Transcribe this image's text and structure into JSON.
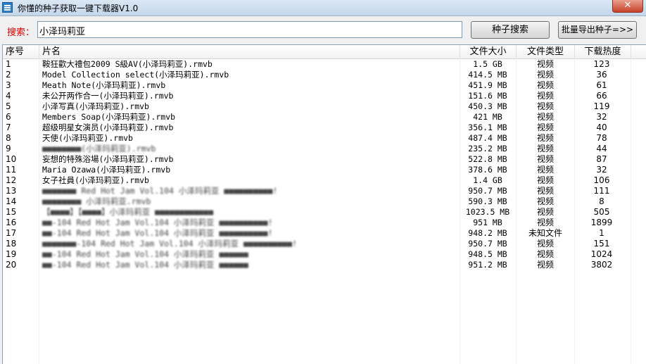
{
  "window": {
    "title": "你懂的种子获取一键下载器V1.0",
    "close_glyph": "✕"
  },
  "search": {
    "label": "搜索：",
    "value": "小泽玛莉亚",
    "search_button": "种子搜索",
    "export_button": "批量导出种子=>>"
  },
  "table": {
    "columns": [
      "序号",
      "片名",
      "文件大小",
      "文件类型",
      "下载热度"
    ],
    "rows": [
      {
        "idx": "1",
        "name": "鞍狂歡大禮包2009 S級AV(小泽玛莉亚).rmvb",
        "size": "1.5 GB",
        "type": "视频",
        "heat": "123"
      },
      {
        "idx": "2",
        "name": "Model Collection select(小泽玛莉亚).rmvb",
        "size": "414.5 MB",
        "type": "视频",
        "heat": "36"
      },
      {
        "idx": "3",
        "name": "Meath Note(小泽玛莉亚).rmvb",
        "size": "451.9 MB",
        "type": "视频",
        "heat": "61"
      },
      {
        "idx": "4",
        "name": "未公开两作合一(小泽玛莉亚).rmvb",
        "size": "151.6 MB",
        "type": "视频",
        "heat": "66"
      },
      {
        "idx": "5",
        "name": "小泽写真(小泽玛莉亚).rmvb",
        "size": "450.3 MB",
        "type": "视频",
        "heat": "119"
      },
      {
        "idx": "6",
        "name": "Members Soap(小泽玛莉亚).rmvb",
        "size": "421 MB",
        "type": "视频",
        "heat": "32"
      },
      {
        "idx": "7",
        "name": "超级明星女演员(小泽玛莉亚).rmvb",
        "size": "356.1 MB",
        "type": "视频",
        "heat": "40"
      },
      {
        "idx": "8",
        "name": "天使(小泽玛莉亚).rmvb",
        "size": "487.4 MB",
        "type": "视频",
        "heat": "78"
      },
      {
        "idx": "9",
        "name": "■■■■■■■■(小泽玛莉亚).rmvb",
        "size": "235.2 MB",
        "type": "视频",
        "heat": "44",
        "blurred": true
      },
      {
        "idx": "10",
        "name": "妄想的特殊浴場(小泽玛莉亚).rmvb",
        "size": "522.8 MB",
        "type": "视频",
        "heat": "87"
      },
      {
        "idx": "11",
        "name": "Maria Ozawa(小泽玛莉亚).rmvb",
        "size": "378.6 MB",
        "type": "视频",
        "heat": "32"
      },
      {
        "idx": "12",
        "name": "女子社員(小泽玛莉亚).rmvb",
        "size": "1.4 GB",
        "type": "视频",
        "heat": "106"
      },
      {
        "idx": "13",
        "name": "■■■■■■■ Red Hot Jam Vol.104 小泽玛莉亚 ■■■■■■■■■■!",
        "size": "950.7 MB",
        "type": "视频",
        "heat": "111",
        "blurred": true
      },
      {
        "idx": "14",
        "name": "■■■■■■■■ 小泽玛莉亚.rmvb",
        "size": "590.3 MB",
        "type": "视频",
        "heat": "8",
        "blurred": true
      },
      {
        "idx": "15",
        "name": "【■■■■】【■■■■】小泽玛莉亚 ■■■■■■■■■■■■",
        "size": "1023.5 MB",
        "type": "视频",
        "heat": "505",
        "blurred": true
      },
      {
        "idx": "16",
        "name": "■■-104 Red Hot Jam Vol.104 小泽玛莉亚 ■■■■■■■■■■!",
        "size": "951 MB",
        "type": "视频",
        "heat": "1899",
        "blurred": true
      },
      {
        "idx": "17",
        "name": "■■-104 Red Hot Jam Vol.104 小泽玛莉亚 ■■■■■■■■■■!",
        "size": "948.2 MB",
        "type": "未知文件",
        "heat": "1",
        "blurred": true
      },
      {
        "idx": "18",
        "name": "■■■■■■■-104 Red Hot Jam Vol.104 小泽玛莉亚 ■■■■■■■■■■!",
        "size": "950.7 MB",
        "type": "视频",
        "heat": "151",
        "blurred": true
      },
      {
        "idx": "19",
        "name": "■■-104 Red Hot Jam Vol.104 小泽玛莉亚 ■■■■■■",
        "size": "948.5 MB",
        "type": "视频",
        "heat": "1024",
        "blurred": true
      },
      {
        "idx": "20",
        "name": "■■-104 Red Hot Jam Vol.104 小泽玛莉亚 ■■■■■■",
        "size": "951.2 MB",
        "type": "视频",
        "heat": "3802",
        "blurred": true
      }
    ]
  }
}
